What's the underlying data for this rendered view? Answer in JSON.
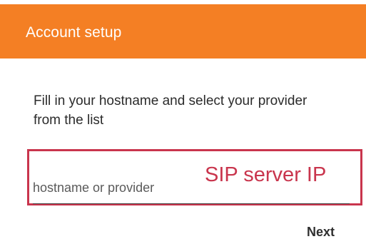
{
  "app_bar": {
    "title": "Account setup",
    "color": "#f47f24"
  },
  "instructions": {
    "text": "Fill in your hostname and select your provider from the list"
  },
  "hostname_input": {
    "placeholder": "hostname or provider",
    "value": ""
  },
  "annotation": {
    "label": "SIP server IP",
    "color": "#c9354d"
  },
  "actions": {
    "next_label": "Next"
  }
}
